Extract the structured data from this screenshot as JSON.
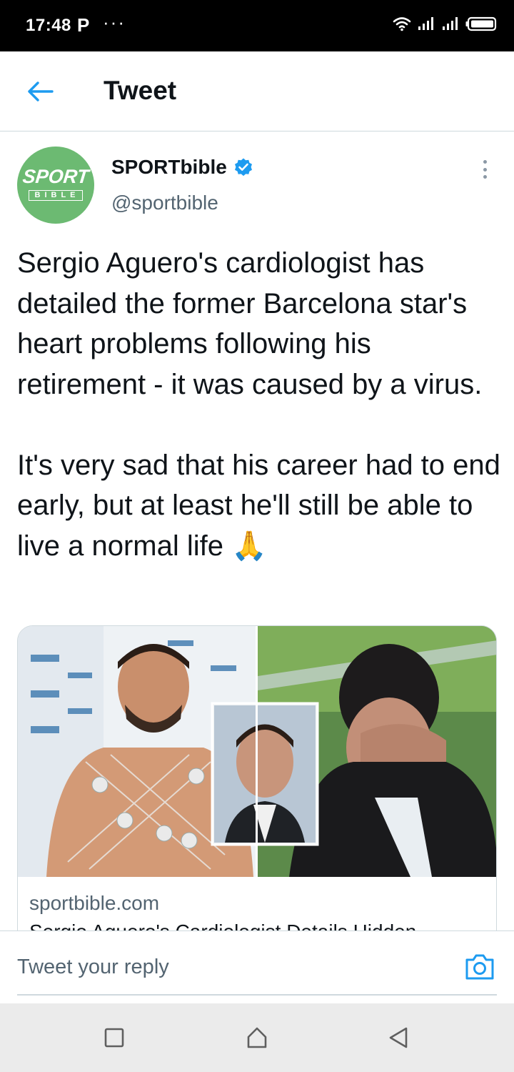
{
  "status_bar": {
    "time": "17:48",
    "app_indicator": "P",
    "more_indicator": "···",
    "icons": [
      "wifi-icon",
      "signal-icon",
      "signal-icon",
      "battery-icon"
    ]
  },
  "header": {
    "back_icon": "arrow-left-icon",
    "title": "Tweet"
  },
  "tweet": {
    "author": {
      "avatar_text_top": "SPORT",
      "avatar_text_bottom": "BIBLE",
      "name": "SPORTbible",
      "verified": true,
      "handle": "@sportbible"
    },
    "text": "Sergio Aguero's cardiologist has detailed the former Barcelona star's heart problems following his retirement - it was caused by a virus.\n\nIt's very sad that his career had to end early, but at least he'll still be able to live a normal life 🙏",
    "card": {
      "domain": "sportbible.com",
      "title": "Sergio Aguero's Cardiologist Details Hidden"
    }
  },
  "reply": {
    "placeholder": "Tweet your reply",
    "camera_icon": "camera-icon"
  },
  "nav_bar": {
    "icons": [
      "recents-square-icon",
      "home-icon",
      "back-triangle-icon"
    ]
  },
  "colors": {
    "accent": "#1d9bf0",
    "text_primary": "#0f1419",
    "text_secondary": "#536471",
    "avatar_bg": "#6cba72",
    "divider": "#cfd9de",
    "status_bar_bg": "#000000",
    "nav_bar_bg": "#ebebeb"
  }
}
